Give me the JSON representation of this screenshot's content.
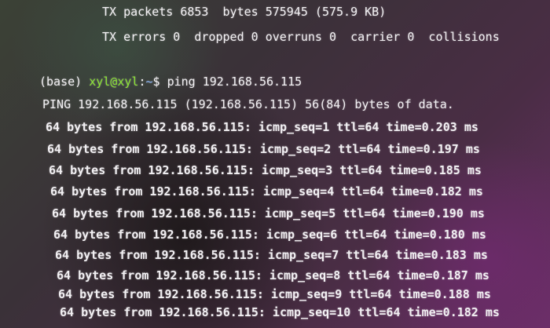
{
  "terminal": {
    "tx_packets": "TX packets 6853  bytes 575945 (575.9 KB)",
    "tx_errors": "TX errors 0  dropped 0 overruns 0  carrier 0  collisions",
    "prompt_env": "(base) ",
    "prompt_user": "xyl@xyl",
    "prompt_sep": ":",
    "prompt_path": "~",
    "prompt_end": "$ ",
    "command": "ping 192.168.56.115",
    "ping_header": "PING 192.168.56.115 (192.168.56.115) 56(84) bytes of data.",
    "replies": [
      "64 bytes from 192.168.56.115: icmp_seq=1 ttl=64 time=0.203 ms",
      "64 bytes from 192.168.56.115: icmp_seq=2 ttl=64 time=0.197 ms",
      "64 bytes from 192.168.56.115: icmp_seq=3 ttl=64 time=0.185 ms",
      "64 bytes from 192.168.56.115: icmp_seq=4 ttl=64 time=0.182 ms",
      "64 bytes from 192.168.56.115: icmp_seq=5 ttl=64 time=0.190 ms",
      "64 bytes from 192.168.56.115: icmp_seq=6 ttl=64 time=0.180 ms",
      "64 bytes from 192.168.56.115: icmp_seq=7 ttl=64 time=0.183 ms",
      "64 bytes from 192.168.56.115: icmp_seq=8 ttl=64 time=0.187 ms",
      "64 bytes from 192.168.56.115: icmp_seq=9 ttl=64 time=0.188 ms",
      "64 bytes from 192.168.56.115: icmp_seq=10 ttl=64 time=0.182 ms"
    ]
  },
  "colors": {
    "text": "#f2f0f3",
    "user": "#8be234",
    "path": "#8ab4f8"
  }
}
